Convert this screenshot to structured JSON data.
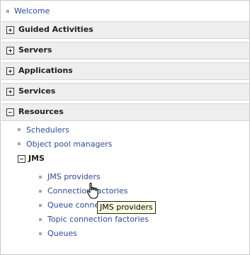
{
  "nav": {
    "welcome": "Welcome",
    "sections": {
      "guided_activities": "Guided Activities",
      "servers": "Servers",
      "applications": "Applications",
      "services": "Services",
      "resources": "Resources"
    },
    "resources": {
      "schedulers": "Schedulers",
      "object_pool_managers": "Object pool managers",
      "jms": {
        "label": "JMS",
        "jms_providers": "JMS providers",
        "connection_factories": "Connection factories",
        "queue_connection_factories": "Queue connection factories",
        "topic_connection_factories": "Topic connection factories",
        "queues": "Queues"
      }
    }
  },
  "tooltip": {
    "text": "JMS providers"
  },
  "colors": {
    "link": "#2a4a9a",
    "section_bg": "#eeeeee",
    "tooltip_bg": "#ffffe1"
  }
}
